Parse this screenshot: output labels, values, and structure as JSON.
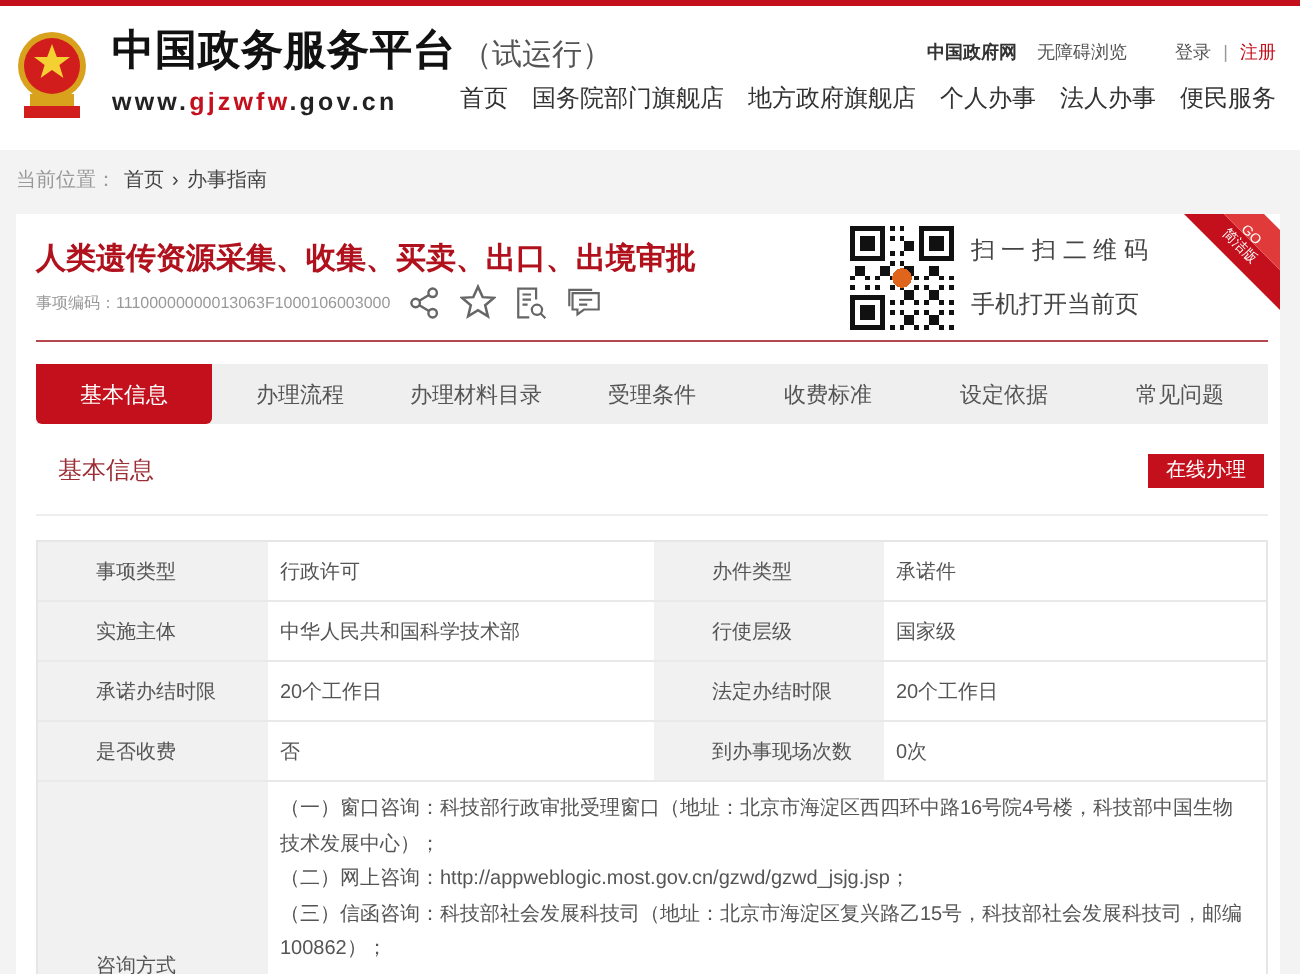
{
  "header": {
    "site_title": "中国政务服务平台",
    "trial_label": "（试运行）",
    "url_parts": [
      {
        "text": "www.",
        "highlight": false
      },
      {
        "text": "gjzwfw",
        "highlight": true
      },
      {
        "text": ".gov.cn",
        "highlight": false
      }
    ],
    "top_links": [
      {
        "label": "中国政府网",
        "kind": "bold"
      },
      {
        "label": "无障碍浏览",
        "kind": "plain"
      }
    ],
    "account": {
      "login": "登录",
      "separator": "|",
      "register": "注册"
    },
    "nav": [
      "首页",
      "国务院部门旗舰店",
      "地方政府旗舰店",
      "个人办事",
      "法人办事",
      "便民服务"
    ]
  },
  "breadcrumb": {
    "label": "当前位置：",
    "items": [
      "首页",
      "办事指南"
    ],
    "separator": "›"
  },
  "item": {
    "title": "人类遗传资源采集、收集、买卖、出口、出境审批",
    "code_label": "事项编码：",
    "code": "11100000000013063F1000106003000",
    "qr": {
      "line_1": "扫 一 扫 二 维 码",
      "line_2": "手机打开当前页"
    },
    "ribbon": {
      "go": "GO",
      "label": "简洁版"
    }
  },
  "tabs": [
    {
      "label": "基本信息",
      "selected": true
    },
    {
      "label": "办理流程",
      "selected": false
    },
    {
      "label": "办理材料目录",
      "selected": false
    },
    {
      "label": "受理条件",
      "selected": false
    },
    {
      "label": "收费标准",
      "selected": false
    },
    {
      "label": "设定依据",
      "selected": false
    },
    {
      "label": "常见问题",
      "selected": false
    }
  ],
  "section": {
    "title": "基本信息",
    "action": "在线办理"
  },
  "info_table": {
    "rows": [
      [
        {
          "label": "事项类型",
          "value": "行政许可"
        },
        {
          "label": "办件类型",
          "value": "承诺件"
        }
      ],
      [
        {
          "label": "实施主体",
          "value": "中华人民共和国科学技术部"
        },
        {
          "label": "行使层级",
          "value": "国家级"
        }
      ],
      [
        {
          "label": "承诺办结时限",
          "value": "20个工作日"
        },
        {
          "label": "法定办结时限",
          "value": "20个工作日"
        }
      ],
      [
        {
          "label": "是否收费",
          "value": "否"
        },
        {
          "label": "到办事现场次数",
          "value": "0次"
        }
      ]
    ],
    "consult": {
      "label": "咨询方式",
      "lines": [
        "（一）窗口咨询：科技部行政审批受理窗口（地址：北京市海淀区西四环中路16号院4号楼，科技部中国生物技术发展中心）；",
        "（二）网上咨询：http://appweblogic.most.gov.cn/gzwd/gzwd_jsjg.jsp；",
        "（三）信函咨询：科技部社会发展科技司（地址：北京市海淀区复兴路乙15号，科技部社会发展科技司，邮编100862）；"
      ]
    }
  }
}
